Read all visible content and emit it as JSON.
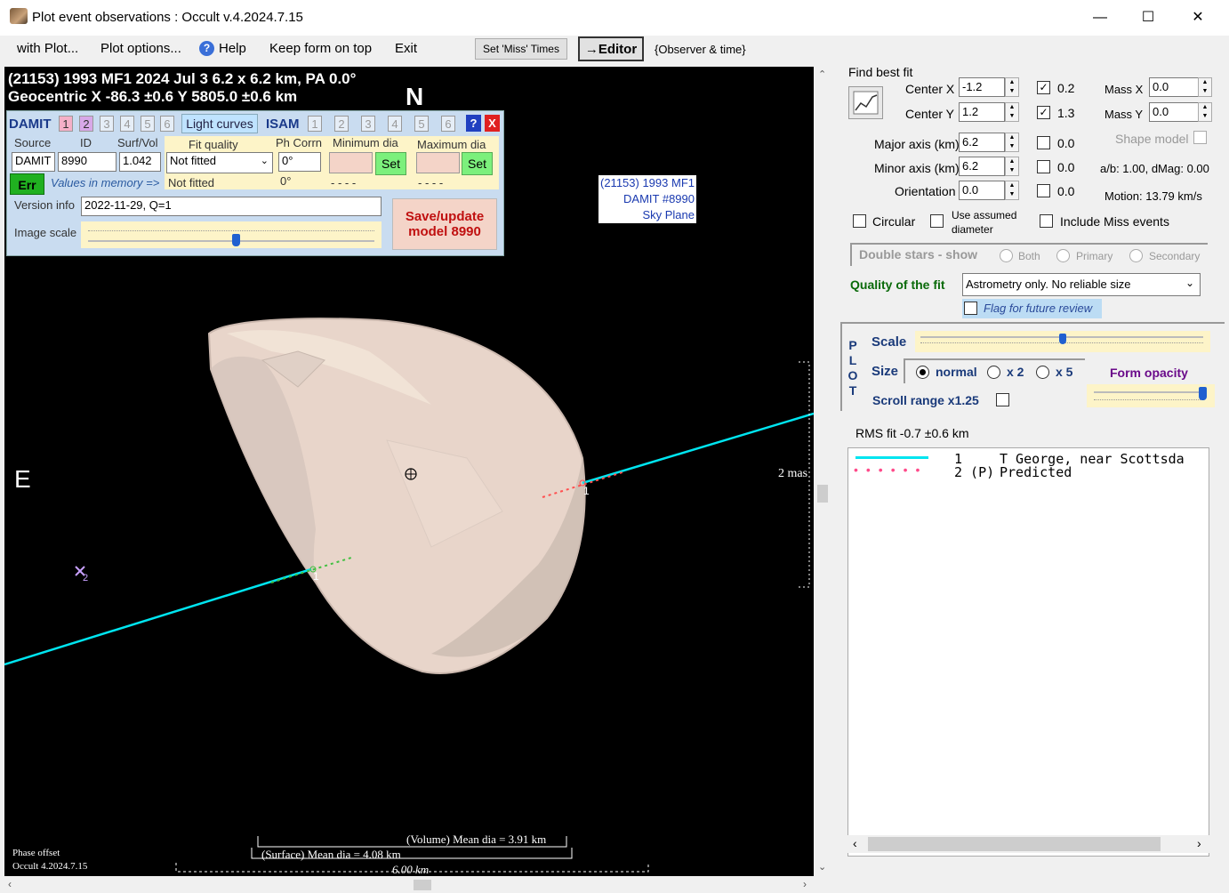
{
  "window": {
    "title": "Plot event observations : Occult v.4.2024.7.15"
  },
  "menu": {
    "with_plot": "with Plot...",
    "plot_options": "Plot options...",
    "help": "Help",
    "keep_on_top": "Keep form on top",
    "exit": "Exit",
    "set_miss": "Set 'Miss' Times",
    "editor": "→Editor",
    "observer_time": "{Observer & time}"
  },
  "plot": {
    "header_line1": "(21153) 1993 MF1  2024 Jul 3  6.2 x 6.2 km, PA 0.0°",
    "header_line2": "Geocentric  X  -86.3 ±0.6  Y 5805.0 ±0.6 km",
    "north": "N",
    "east": "E",
    "object_box": [
      "(21153) 1993 MF1",
      "DAMIT #8990",
      "Sky Plane"
    ],
    "chord1_label": "1",
    "chord2_label": "1",
    "star2_label": "2",
    "mas_label": "2 mas",
    "volume_dia": "(Volume) Mean dia = 3.91 km",
    "surface_dia": "(Surface) Mean dia = 4.08 km",
    "scale_len": "6.00 km",
    "phase_offset": "Phase offset",
    "version": "Occult 4.2024.7.15"
  },
  "damit": {
    "title": "DAMIT",
    "tabs": [
      "1",
      "2",
      "3",
      "4",
      "5",
      "6"
    ],
    "light_curves": "Light curves",
    "isam": "ISAM",
    "isam_tabs": [
      "1",
      "2",
      "3",
      "4",
      "5",
      "6"
    ],
    "help": "?",
    "close": "X",
    "source_label": "Source",
    "id_label": "ID",
    "surfvol_label": "Surf/Vol",
    "fit_quality_label": "Fit quality",
    "ph_corrn_label": "Ph Corrn",
    "min_dia_label": "Minimum dia",
    "max_dia_label": "Maximum dia",
    "source": "DAMIT",
    "id": "8990",
    "surfvol": "1.042",
    "fit_quality": "Not fitted",
    "ph_corrn": "0°",
    "set_min": "Set",
    "set_max": "Set",
    "err": "Err",
    "values_in_memory": "Values in memory =>",
    "mem_fit": "Not fitted",
    "mem_ph": "0°",
    "mem_min": "- - - -",
    "mem_max": "- - - -",
    "version_info_label": "Version info",
    "version_info": "2022-11-29, Q=1",
    "image_scale_label": "Image scale",
    "save_update": "Save/update",
    "save_model": "model 8990"
  },
  "right": {
    "find_best_fit": "Find best fit",
    "center_x_label": "Center X",
    "center_x": "-1.2",
    "center_y_label": "Center Y",
    "center_y": "1.2",
    "cx_step": "0.2",
    "cy_step": "1.3",
    "mass_x_label": "Mass X",
    "mass_x": "0.0",
    "mass_y_label": "Mass Y",
    "mass_y": "0.0",
    "major_label": "Major axis (km)",
    "major": "6.2",
    "major_step": "0.0",
    "minor_label": "Minor axis (km)",
    "minor": "6.2",
    "minor_step": "0.0",
    "orient_label": "Orientation",
    "orient": "0.0",
    "orient_step": "0.0",
    "shape_model": "Shape model",
    "ab": "a/b: 1.00, dMag: 0.00",
    "motion": "Motion: 13.79 km/s",
    "circular": "Circular",
    "use_assumed": "Use assumed",
    "diameter": "diameter",
    "include_miss": "Include Miss events",
    "double_stars": "Double stars - show",
    "both": "Both",
    "primary": "Primary",
    "secondary": "Secondary",
    "quality_label": "Quality of the fit",
    "quality_value": "Astrometry only. No reliable size",
    "flag_review": "Flag for future review",
    "plot_vertical": [
      "P",
      "L",
      "O",
      "T"
    ],
    "scale": "Scale",
    "size": "Size",
    "normal": "normal",
    "x2": "x 2",
    "x5": "x 5",
    "form_opacity": "Form opacity",
    "scroll_range": "Scroll range x1.25",
    "rms": "RMS fit -0.7 ±0.6 km",
    "legend": [
      {
        "num": "1",
        "text": "T George, near Scottsda"
      },
      {
        "num": "2 (P)",
        "text": "Predicted"
      }
    ]
  },
  "colors": {
    "chord": "#00e5f0",
    "shape": "#e8d4c8",
    "damit_panel": "#c9dcf0",
    "green": "#7cf07c"
  }
}
